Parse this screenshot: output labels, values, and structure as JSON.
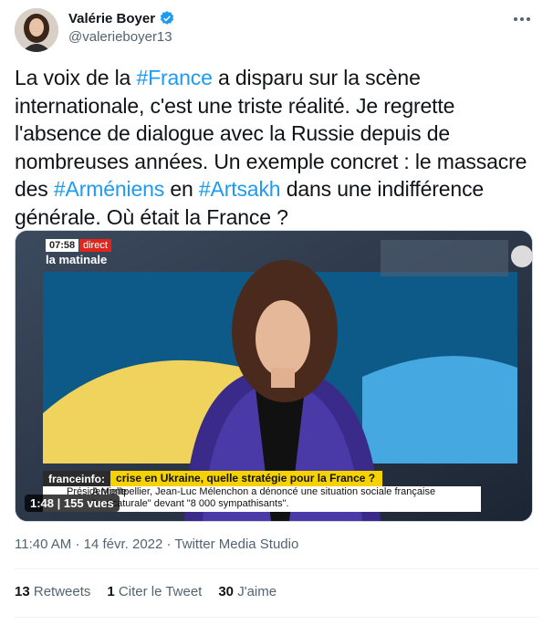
{
  "author": {
    "name": "Valérie Boyer",
    "handle": "@valerieboyer13",
    "verified_icon": "verified-badge-icon",
    "accent_color": "#1d9bf0"
  },
  "tweet": {
    "segments": [
      {
        "text": "La voix de la ",
        "tag": false
      },
      {
        "text": "#France",
        "tag": true
      },
      {
        "text": " a disparu sur la scène internationale, c'est une triste réalité. Je regrette l'absence de dialogue avec la Russie depuis de nombreuses années. Un exemple concret : le massacre des ",
        "tag": false
      },
      {
        "text": "#Arméniens",
        "tag": true
      },
      {
        "text": " en ",
        "tag": false
      },
      {
        "text": "#Artsakh",
        "tag": true
      },
      {
        "text": " dans une indifférence générale. Où était la France ?",
        "tag": false
      }
    ]
  },
  "video": {
    "time_badge": "07:58",
    "live_badge": "direct",
    "show_name": "la matinale",
    "channel": "franceinfo:",
    "headline": "crise en Ukraine, quelle stratégie pour la France ?",
    "ticker_label": "Présidentielle",
    "ticker_text": "A Montpellier, Jean-Luc Mélenchon a dénoncé une situation sociale française \"caricaturale\" devant \"8 000 sympathisants\".",
    "duration": "1:48",
    "views": "155 vues"
  },
  "meta": {
    "time": "11:40 AM",
    "date": "14 févr. 2022",
    "source": "Twitter Media Studio"
  },
  "stats": {
    "retweets_count": "13",
    "retweets_label": "Retweets",
    "quotes_count": "1",
    "quotes_label": "Citer le Tweet",
    "likes_count": "30",
    "likes_label": "J'aime"
  }
}
